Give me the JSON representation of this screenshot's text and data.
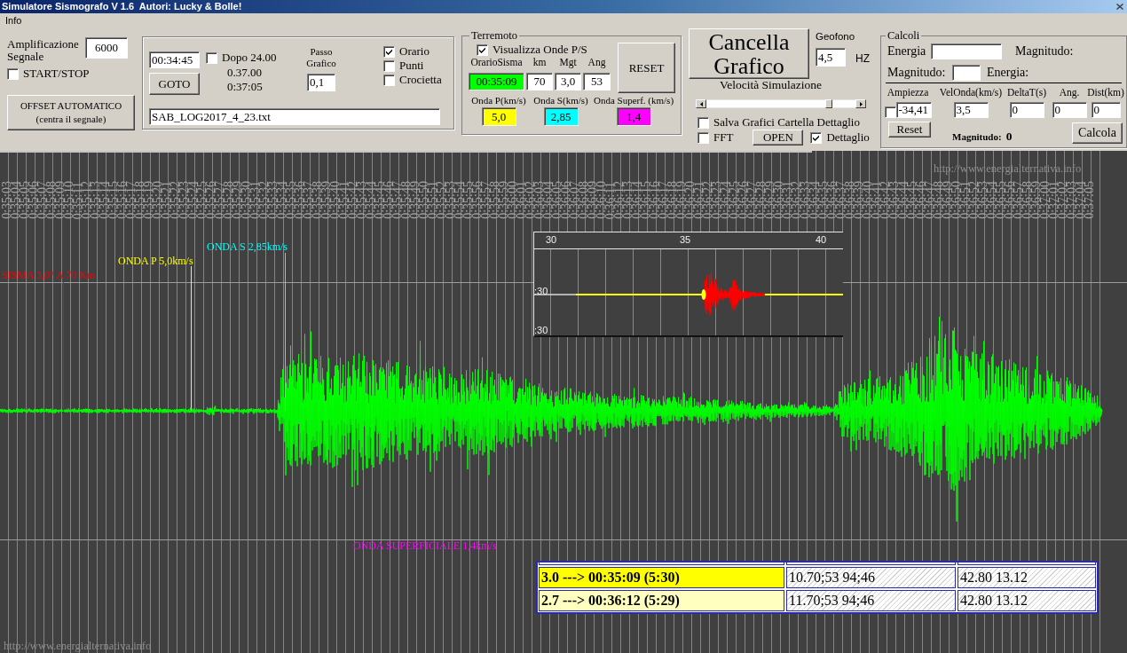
{
  "window": {
    "title": "Simulatore Sismografo V 1.6  Autori: Lucky & Bolle!"
  },
  "menu": [
    {
      "label": "Info"
    }
  ],
  "amplification": {
    "label": "Amplificazione Segnale",
    "value": "6000"
  },
  "start_stop": {
    "label": "START/STOP",
    "checked": false
  },
  "offset_button": {
    "lines": [
      "OFFSET AUTOMATICO",
      "(centra il segnale)"
    ]
  },
  "navigation": {
    "time": "00:34:45",
    "after_midnight": {
      "label": "Dopo 24.00",
      "checked": false
    },
    "readings": [
      "0.37.00",
      "0:37:05"
    ],
    "goto_button": "GOTO",
    "step": {
      "label": "Passo Grafico",
      "value": "0,1"
    },
    "options": [
      {
        "label": "Orario",
        "checked": true
      },
      {
        "label": "Punti",
        "checked": false
      },
      {
        "label": "Crocietta",
        "checked": false
      }
    ],
    "file": "SAB_LOG2017_4_23.txt"
  },
  "earthquake": {
    "title": "Terremoto",
    "show_waves": {
      "label": "Visualizza Onde P/S",
      "checked": true
    },
    "fields": [
      {
        "label": "OrarioSisma",
        "value": "00:35:09",
        "color": "#00ff00"
      },
      {
        "label": "km",
        "value": "70"
      },
      {
        "label": "Mgt",
        "value": "3,0"
      },
      {
        "label": "Ang",
        "value": "53"
      }
    ],
    "reset_button": "RESET",
    "waves": [
      {
        "label": "Onda P(km/s)",
        "value": "5,0",
        "color": "#ffff00"
      },
      {
        "label": "Onda S(km/s)",
        "value": "2,85",
        "color": "#00ffff"
      },
      {
        "label": "Onda Superf. (km/s)",
        "value": "1,4",
        "color": "#ff00ff"
      }
    ]
  },
  "clear_button": {
    "lines": [
      "Cancella",
      "Grafico"
    ]
  },
  "geophone": {
    "label": "Geofono",
    "value": "4,5",
    "unit": "HZ"
  },
  "speed": {
    "label": "Velocità Simulazione",
    "level": 0.84
  },
  "save_charts": {
    "label": "Salva Grafici Cartella Dettaglio",
    "checked": false
  },
  "fft": {
    "label": "FFT",
    "checked": false
  },
  "open_button": "OPEN",
  "detail": {
    "label": "Dettaglio",
    "checked": true
  },
  "calculations": {
    "title": "Calcoli",
    "energy_input": {
      "label": "Energia"
    },
    "energy_result_label": "Magnitudo:",
    "magnitude_input": {
      "label": "Magnitudo:"
    },
    "magnitude_result_label": "Energia:",
    "amplitude_check": {
      "checked": false
    },
    "columns": [
      {
        "label": "Ampiezza",
        "value": "-34,41"
      },
      {
        "label": "VelOnda(km/s)",
        "value": "3,5"
      },
      {
        "label": "DeltaT(s)",
        "value": "0"
      },
      {
        "label": "Ang.",
        "value": "0"
      },
      {
        "label": "Dist(km)",
        "value": "0"
      }
    ],
    "reset_button": "Reset",
    "magnitude": {
      "label": "Magnitudo:",
      "value": "0"
    },
    "calculate_button": "Calcola"
  },
  "chart": {
    "site_urls": [
      "http://www.energialternativa.info",
      "http://www.energialternativa.info"
    ],
    "time_labels": [
      "0:35:03",
      "0:35:04",
      "0:35:05",
      "0:35:06",
      "0:35:07",
      "0:35:08",
      "0:35:09",
      "0:35:10",
      "0:35:11",
      "0:35:12",
      "0:35:13",
      "0:35:14",
      "0:35:15",
      "0:35:16",
      "0:35:17",
      "0:35:18",
      "0:35:19",
      "0:35:20",
      "0:35:21",
      "0:35:22",
      "0:35:23",
      "0:35:24",
      "0:35:25",
      "0:35:26",
      "0:35:27",
      "0:35:28",
      "0:35:29",
      "0:35:30",
      "0:35:31",
      "0:35:32",
      "0:35:33",
      "0:35:34",
      "0:35:35",
      "0:35:36",
      "0:35:37",
      "0:35:38",
      "0:35:39",
      "0:35:40",
      "0:35:41",
      "0:35:42",
      "0:35:43",
      "0:35:44",
      "0:35:45",
      "0:35:46",
      "0:35:47",
      "0:35:48",
      "0:35:49",
      "0:35:50",
      "0:35:51",
      "0:35:52",
      "0:35:53",
      "0:35:54",
      "0:35:55",
      "0:35:56",
      "0:35:57",
      "0:35:58",
      "0:35:59",
      "0:36:00",
      "0:36:01",
      "0:36:02",
      "0:36:03",
      "0:36:04",
      "0:36:05",
      "0:36:06",
      "0:36:07",
      "0:36:08",
      "0:36:09",
      "0:36:10",
      "0:36:11",
      "0:36:12",
      "0:36:13",
      "0:36:14",
      "0:36:15",
      "0:36:16",
      "0:36:17",
      "0:36:18",
      "0:36:19",
      "0:36:20",
      "0:36:21",
      "0:36:22",
      "0:36:23",
      "0:36:24",
      "0:36:25",
      "0:36:26",
      "0:36:27",
      "0:36:28",
      "0:36:29",
      "0:36:30",
      "0:36:31",
      "0:36:32",
      "0:36:33",
      "0:36:34",
      "0:36:35",
      "0:36:36",
      "0:36:37",
      "0:36:38",
      "0:36:39",
      "0:36:40",
      "0:36:41",
      "0:36:42",
      "0:36:43",
      "0:36:44",
      "0:36:45",
      "0:36:46",
      "0:36:47",
      "0:36:48",
      "0:36:49",
      "0:36:50",
      "0:36:51",
      "0:36:52",
      "0:36:53",
      "0:36:54",
      "0:36:55",
      "0:36:56",
      "0:36:57",
      "0:36:58",
      "0:36:59",
      "0:37:00",
      "0:37:01",
      "0:37:02",
      "0:37:03",
      "0:37:04",
      "0:37:05"
    ],
    "markers": [
      {
        "label": "SISMA 3,0° A 70 Km",
        "color": "#ff0000"
      },
      {
        "label": "ONDA P 5,0km/s",
        "color": "#ffff00"
      },
      {
        "label": "ONDA S 2,85km/s",
        "color": "#00ffff"
      },
      {
        "label": "ONDA SUPERFICIALE 1,4km/s",
        "color": "#ff00ff"
      }
    ],
    "inset": {
      "x_ticks": [
        "30",
        "35",
        "40"
      ],
      "y_labels": [
        ":30",
        ":30"
      ]
    },
    "results": [
      {
        "selected": true,
        "cells": [
          "3.0 ---> 00:35:09 (5:30)",
          "10.70;53 94;46",
          "42.80 13.12"
        ]
      },
      {
        "selected": false,
        "cells": [
          "2.7 ---> 00:36:12 (5:29)",
          "11.70;53 94;46",
          "42.80 13.12"
        ]
      }
    ]
  }
}
